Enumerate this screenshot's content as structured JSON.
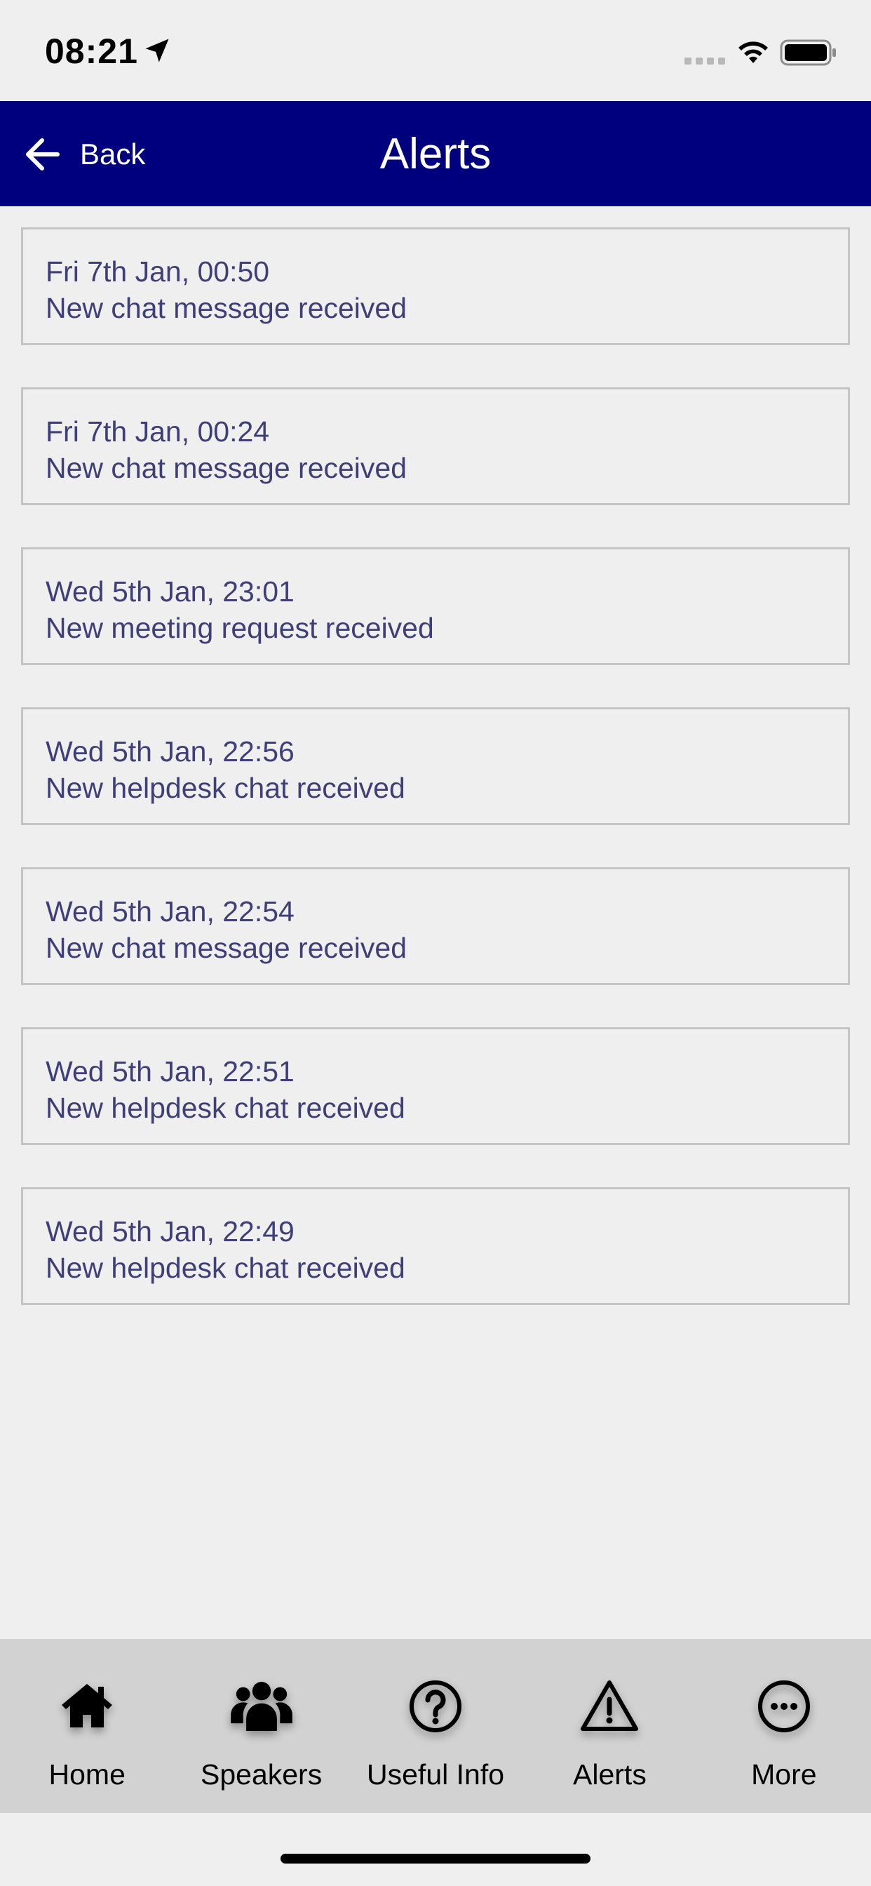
{
  "status_bar": {
    "time": "08:21",
    "icons": [
      "location-arrow-icon",
      "cellular-signal-icon",
      "wifi-icon",
      "battery-icon"
    ]
  },
  "nav": {
    "back_label": "Back",
    "title": "Alerts",
    "background_color": "#00007f"
  },
  "alerts": [
    {
      "date": "Fri 7th Jan, 00:50",
      "message": "New chat message received"
    },
    {
      "date": "Fri 7th Jan, 00:24",
      "message": "New chat message received"
    },
    {
      "date": "Wed 5th Jan, 23:01",
      "message": "New meeting request received"
    },
    {
      "date": "Wed 5th Jan, 22:56",
      "message": "New helpdesk chat received"
    },
    {
      "date": "Wed 5th Jan, 22:54",
      "message": "New chat message received"
    },
    {
      "date": "Wed 5th Jan, 22:51",
      "message": "New helpdesk chat received"
    },
    {
      "date": "Wed 5th Jan, 22:49",
      "message": "New helpdesk chat received"
    }
  ],
  "tabs": [
    {
      "label": "Home",
      "icon": "home-icon"
    },
    {
      "label": "Speakers",
      "icon": "users-icon"
    },
    {
      "label": "Useful Info",
      "icon": "question-circle-icon"
    },
    {
      "label": "Alerts",
      "icon": "warning-triangle-icon"
    },
    {
      "label": "More",
      "icon": "more-circle-icon"
    }
  ]
}
